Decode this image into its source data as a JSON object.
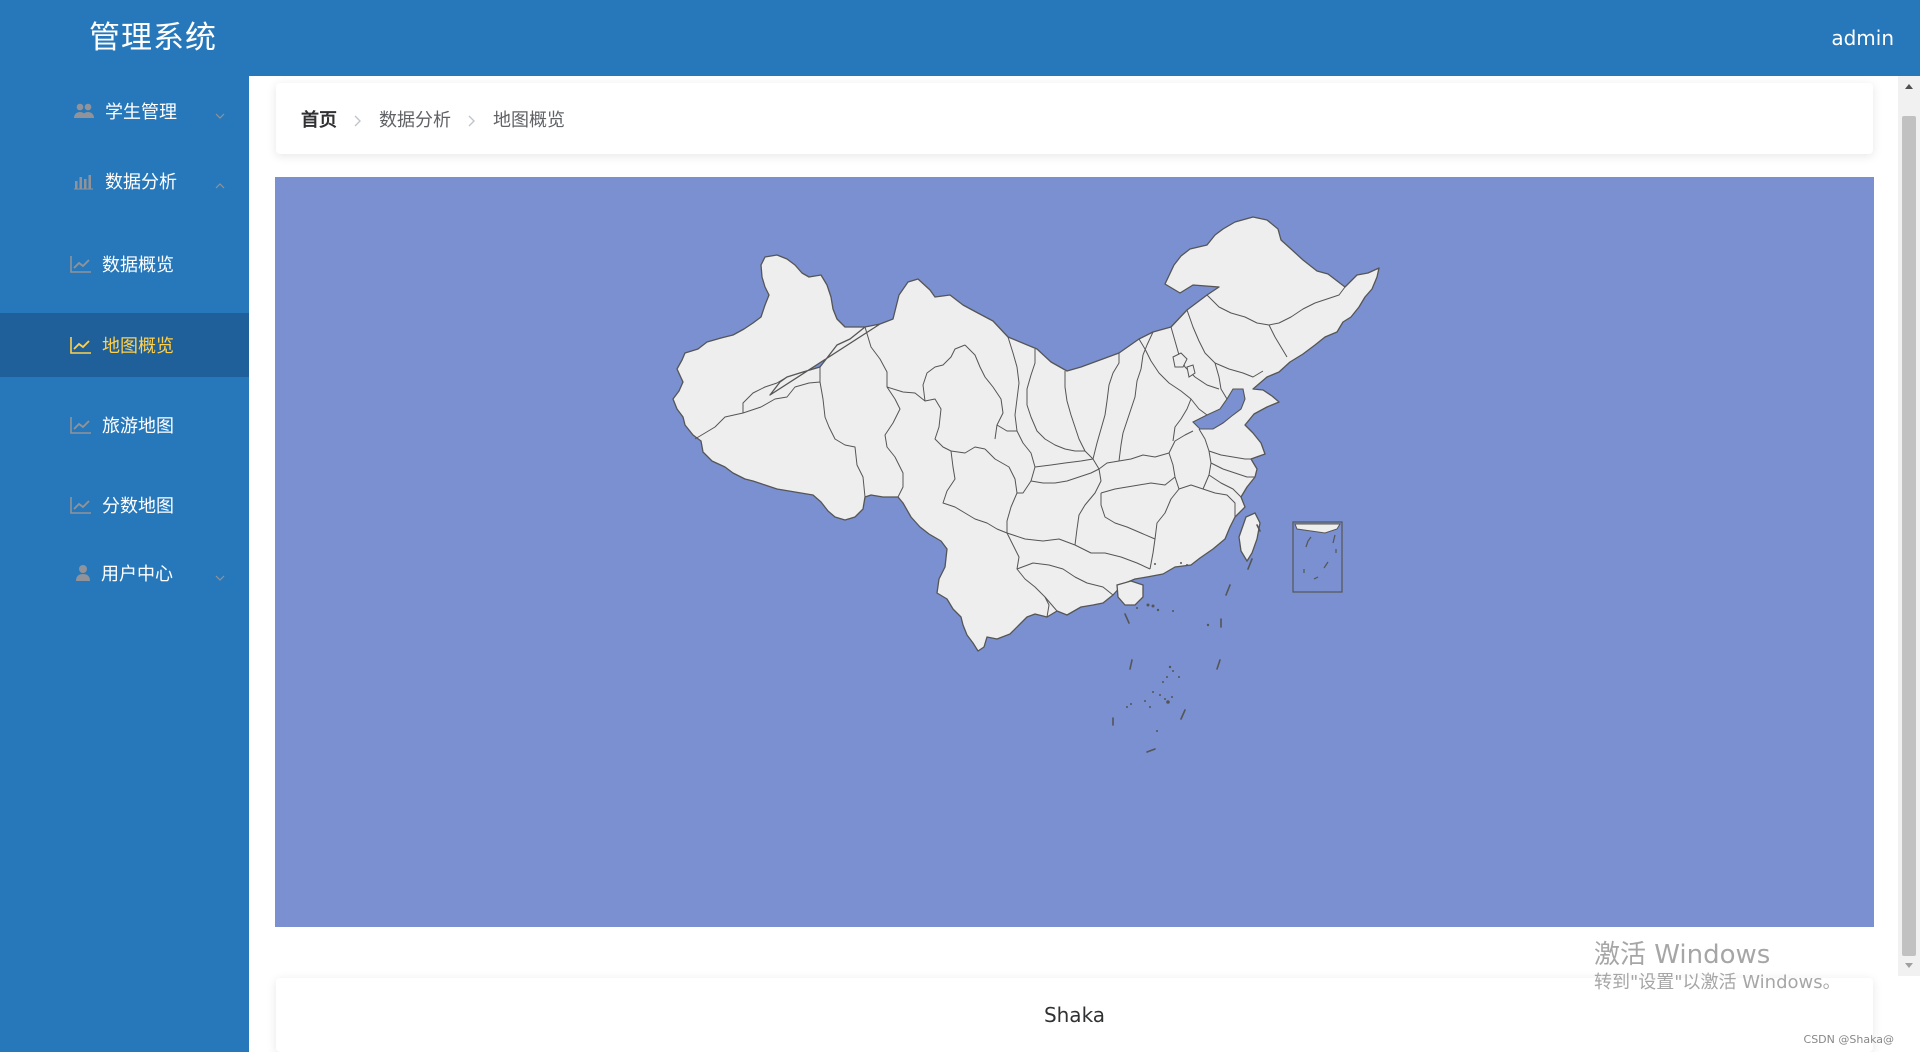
{
  "app": {
    "title": "管理系统"
  },
  "header": {
    "user": "admin"
  },
  "sidebar": {
    "items": [
      {
        "label": "学生管理",
        "icon": "users-icon",
        "arrow": "down"
      },
      {
        "label": "数据分析",
        "icon": "bar-chart-icon",
        "arrow": "up"
      },
      {
        "label": "数据概览",
        "icon": "line-chart-icon"
      },
      {
        "label": "地图概览",
        "icon": "line-chart-icon",
        "active": true
      },
      {
        "label": "旅游地图",
        "icon": "line-chart-icon"
      },
      {
        "label": "分数地图",
        "icon": "line-chart-icon"
      },
      {
        "label": "用户中心",
        "icon": "user-icon",
        "arrow": "down"
      }
    ]
  },
  "breadcrumb": [
    "首页",
    "数据分析",
    "地图概览"
  ],
  "footer": {
    "text": "Shaka"
  },
  "watermark": {
    "title": "激活 Windows",
    "subtitle": "转到\"设置\"以激活 Windows。",
    "csdn": "CSDN @Shaka@"
  },
  "colors": {
    "header_bg": "#2778ba",
    "sidebar_bg": "#2778ba",
    "active_bg": "#1f609b",
    "active_text": "#ffd04b",
    "map_bg": "#7a90d0",
    "map_land": "#eeeeee",
    "map_border": "#555555"
  }
}
